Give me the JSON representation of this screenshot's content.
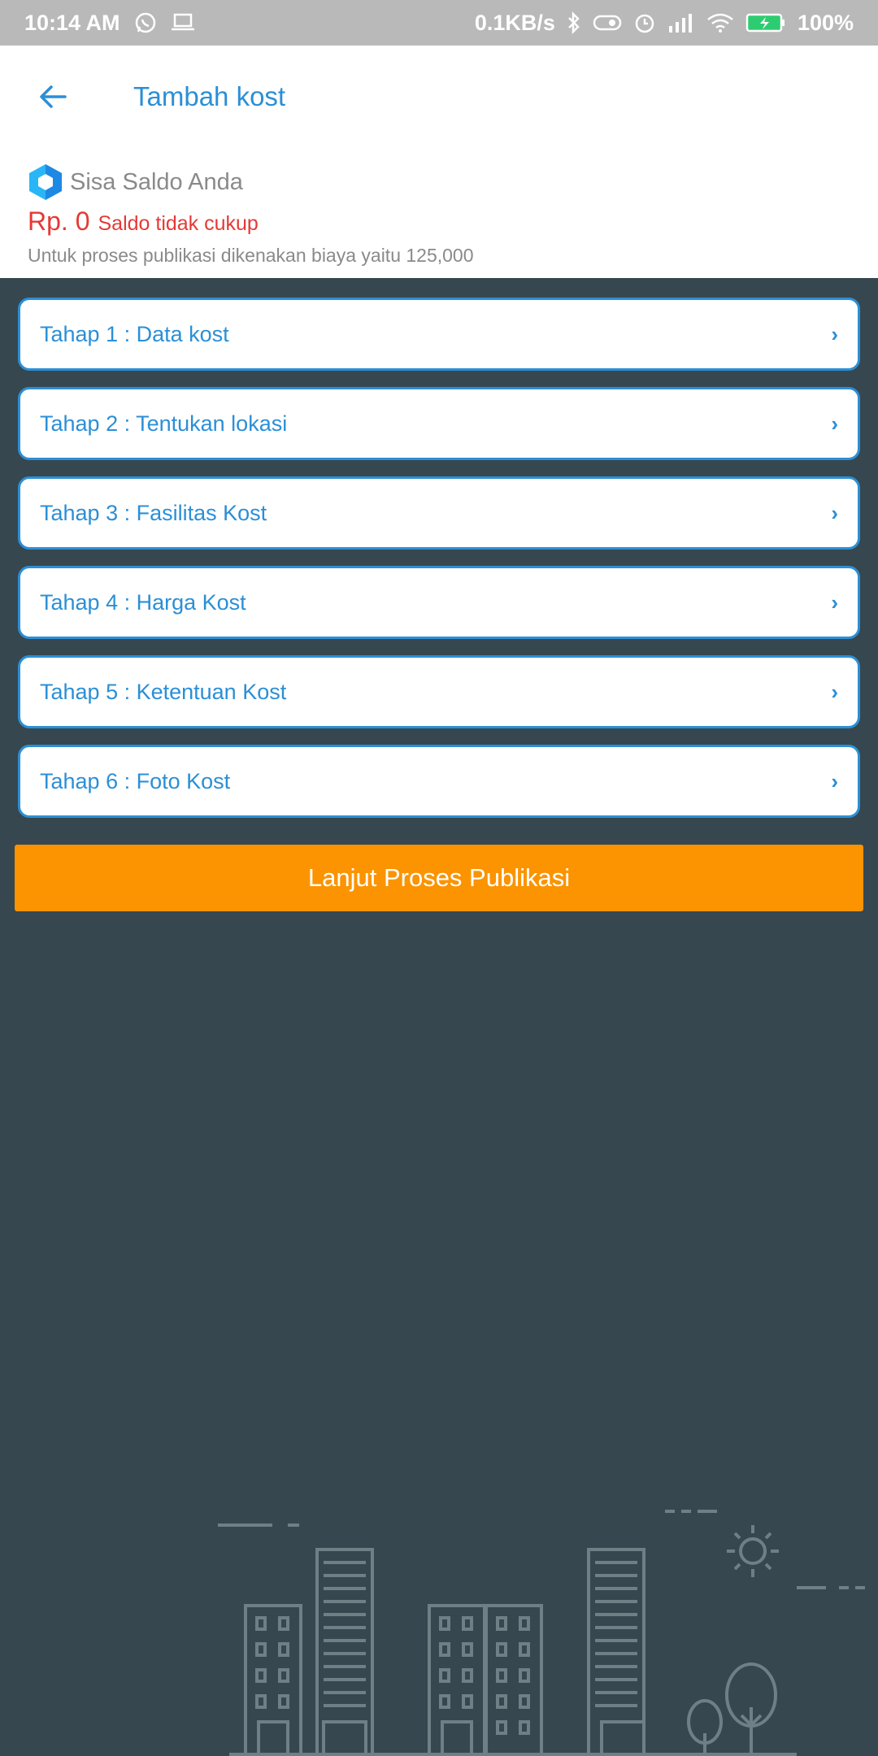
{
  "status_bar": {
    "time": "10:14 AM",
    "net_speed": "0.1KB/s",
    "battery": "100%"
  },
  "app_bar": {
    "title": "Tambah kost"
  },
  "balance": {
    "label": "Sisa Saldo Anda",
    "amount": "Rp. 0",
    "warning": "Saldo tidak cukup",
    "note": "Untuk proses publikasi dikenakan biaya yaitu 125,000"
  },
  "steps": [
    {
      "label": "Tahap 1 : Data kost"
    },
    {
      "label": "Tahap 2 : Tentukan lokasi"
    },
    {
      "label": "Tahap 3 : Fasilitas Kost"
    },
    {
      "label": "Tahap 4 : Harga Kost"
    },
    {
      "label": "Tahap 5 : Ketentuan Kost"
    },
    {
      "label": "Tahap 6 : Foto Kost"
    }
  ],
  "chevron": "›",
  "publish_button": "Lanjut Proses Publikasi",
  "colors": {
    "accent": "#2b8fd6",
    "warning": "#e53935",
    "button": "#fb9400",
    "background": "#37474f"
  }
}
